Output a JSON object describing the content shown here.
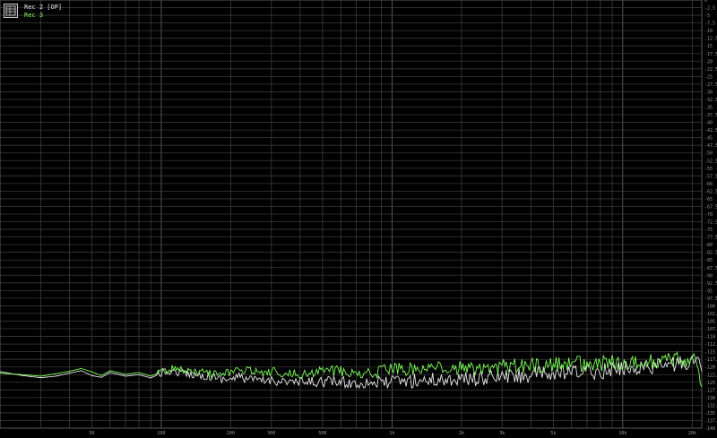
{
  "legend": {
    "items": [
      {
        "label": "Rec 2 [OP]",
        "color": "#e8e8e8"
      },
      {
        "label": "Rec 3",
        "color": "#7cff5a"
      }
    ]
  },
  "chart_data": {
    "type": "line",
    "title": "",
    "xlabel": "",
    "ylabel": "",
    "xscale": "log",
    "xlim": [
      20,
      22000
    ],
    "ylim": [
      -140,
      0
    ],
    "grid": true,
    "legend_position": "top-left",
    "x_ticks": [
      50,
      100,
      200,
      300,
      500,
      1000,
      2000,
      3000,
      5000,
      10000,
      20000
    ],
    "x_tick_labels": [
      "50",
      "100",
      "200",
      "300",
      "500",
      "1k",
      "2k",
      "3k",
      "5k",
      "10k",
      "20k"
    ],
    "y_ticks": [
      0,
      -2.5,
      -5,
      -7.5,
      -10,
      -12.5,
      -15,
      -17.5,
      -20,
      -22.5,
      -25,
      -27.5,
      -30,
      -32.5,
      -35,
      -37.5,
      -40,
      -42.5,
      -45,
      -47.5,
      -50,
      -52.5,
      -55,
      -57.5,
      -60,
      -62.5,
      -65,
      -67.5,
      -70,
      -72.5,
      -75,
      -77.5,
      -80,
      -82.5,
      -85,
      -87.5,
      -90,
      -92.5,
      -95,
      -97.5,
      -100,
      -102.5,
      -105,
      -107.5,
      -110,
      -112.5,
      -115,
      -117.5,
      -120,
      -122.5,
      -125,
      -127.5,
      -130,
      -132.5,
      -135,
      -137.5,
      -140
    ],
    "series": [
      {
        "name": "Rec 2 [OP]",
        "color": "#e8e8e8",
        "x": [
          20,
          25,
          30,
          35,
          40,
          45,
          50,
          55,
          60,
          70,
          80,
          90,
          100,
          110,
          120,
          140,
          160,
          180,
          200,
          220,
          250,
          280,
          300,
          350,
          400,
          450,
          500,
          600,
          700,
          800,
          900,
          1000,
          1200,
          1500,
          2000,
          2500,
          3000,
          3500,
          4000,
          5000,
          6000,
          7000,
          8000,
          9000,
          10000,
          12000,
          14000,
          16000,
          18000,
          20000,
          21000,
          22000
        ],
        "y": [
          -121.5,
          -122.8,
          -123.5,
          -123.0,
          -122.0,
          -121.2,
          -122.8,
          -123.4,
          -121.8,
          -123.0,
          -122.5,
          -123.6,
          -122.0,
          -121.4,
          -121.8,
          -122.5,
          -123.0,
          -123.8,
          -124.0,
          -123.2,
          -124.4,
          -124.6,
          -124.2,
          -124.8,
          -125.2,
          -125.0,
          -124.6,
          -125.0,
          -125.4,
          -124.8,
          -125.3,
          -124.8,
          -124.6,
          -124.2,
          -123.9,
          -123.8,
          -123.2,
          -123.0,
          -122.6,
          -122.4,
          -122.0,
          -121.6,
          -121.4,
          -120.9,
          -120.4,
          -120.0,
          -119.6,
          -119.2,
          -118.8,
          -118.4,
          -117.8,
          -121.5
        ]
      },
      {
        "name": "Rec 3",
        "color": "#7cff5a",
        "x": [
          20,
          25,
          30,
          35,
          40,
          45,
          50,
          55,
          60,
          70,
          80,
          90,
          100,
          110,
          120,
          140,
          160,
          180,
          200,
          220,
          250,
          280,
          300,
          350,
          400,
          450,
          500,
          600,
          700,
          800,
          900,
          1000,
          1200,
          1500,
          2000,
          2500,
          3000,
          3500,
          4000,
          5000,
          6000,
          7000,
          8000,
          9000,
          10000,
          12000,
          14000,
          16000,
          18000,
          20000,
          21000,
          22000
        ],
        "y": [
          -122.0,
          -122.5,
          -123.0,
          -122.2,
          -121.4,
          -120.5,
          -121.6,
          -122.8,
          -121.2,
          -122.4,
          -121.8,
          -123.0,
          -121.5,
          -120.6,
          -121.0,
          -121.6,
          -122.2,
          -122.8,
          -121.8,
          -121.0,
          -121.6,
          -122.0,
          -121.4,
          -121.8,
          -122.2,
          -121.6,
          -121.2,
          -121.4,
          -121.8,
          -121.2,
          -121.6,
          -121.0,
          -120.8,
          -120.6,
          -120.4,
          -120.4,
          -120.0,
          -119.8,
          -119.6,
          -119.4,
          -119.2,
          -119.0,
          -118.9,
          -118.7,
          -118.5,
          -118.3,
          -118.0,
          -117.8,
          -117.6,
          -117.4,
          -117.0,
          -126.5
        ]
      }
    ]
  }
}
